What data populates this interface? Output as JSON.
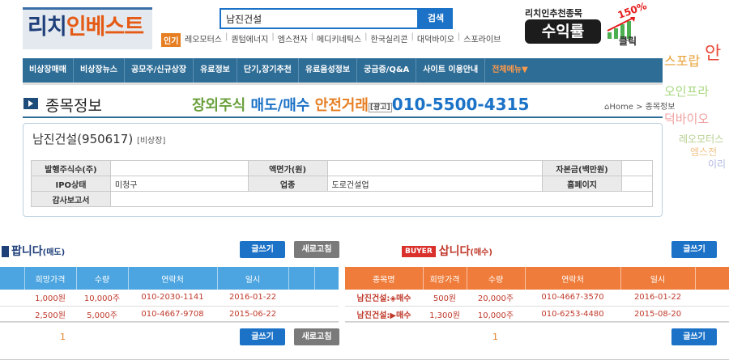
{
  "logo": {
    "part1": "리치",
    "part2": "인베스트"
  },
  "search": {
    "value": "남진건설",
    "button": "검색"
  },
  "popular": {
    "badge": "인기",
    "keywords": [
      "레오모터스",
      "퀀텀에너지",
      "엠스전자",
      "메디키네틱스",
      "한국실리콘",
      "대덕바이오",
      "스포라이브"
    ]
  },
  "recommend": {
    "subtitle": "리치인추천종목",
    "main": "수익률",
    "percent": "150%",
    "click": "클릭"
  },
  "nav": {
    "items": [
      "비상장매매",
      "비상장뉴스",
      "공모주/신규상장",
      "유료정보",
      "단기,장기추천",
      "유료음성정보",
      "궁금증/Q&A",
      "사이트 이용안내"
    ],
    "all_menu": "전체메뉴▼"
  },
  "page": {
    "title": "종목정보"
  },
  "ad": {
    "part1": "장외주식",
    "part2": "매도/매수",
    "part3": "안전거래",
    "tag": "[광고]",
    "phone": "010-5500-4315"
  },
  "breadcrumb": {
    "home": "Home",
    "sep": ">",
    "current": "종목정보"
  },
  "stock": {
    "name": "남진건설(950617)",
    "market": "[비상장]",
    "fields": {
      "shares_label": "발행주식수(주)",
      "shares_value": "",
      "par_label": "액면가(원)",
      "par_value": "",
      "capital_label": "자본금(백만원)",
      "capital_value": "",
      "ipo_label": "IPO상태",
      "ipo_value": "미청구",
      "sector_label": "업종",
      "sector_value": "도로건설업",
      "homepage_label": "홈페이지",
      "homepage_value": "",
      "audit_label": "감사보고서",
      "audit_value": ""
    }
  },
  "cloud": [
    "안",
    "스포랍",
    "오인프라",
    "덕바이오",
    "레오모터스",
    "엠스전",
    "이리"
  ],
  "sell": {
    "title": "팝니다",
    "subtitle": "(매도)",
    "write": "글쓰기",
    "refresh": "새로고침",
    "columns": [
      "희망가격",
      "수량",
      "연락처",
      "일시"
    ],
    "rows": [
      {
        "price": "1,000원",
        "qty": "10,000주",
        "contact": "010-2030-1141",
        "date": "2016-01-22"
      },
      {
        "price": "2,500원",
        "qty": "5,000주",
        "contact": "010-4667-9708",
        "date": "2015-06-22"
      }
    ],
    "page": "1"
  },
  "buy": {
    "badge": "BUYER",
    "title": "삽니다",
    "subtitle": "(매수)",
    "write": "글쓰기",
    "columns": [
      "종목명",
      "희망가격",
      "수량",
      "연락처",
      "일시"
    ],
    "rows": [
      {
        "name": "남진건설:◈매수",
        "price": "500원",
        "qty": "20,000주",
        "contact": "010-4667-3570",
        "date": "2016-01-22"
      },
      {
        "name": "남진건설:▶매수",
        "price": "1,300원",
        "qty": "10,000주",
        "contact": "010-6253-4480",
        "date": "2015-08-20"
      }
    ],
    "page": "1"
  }
}
